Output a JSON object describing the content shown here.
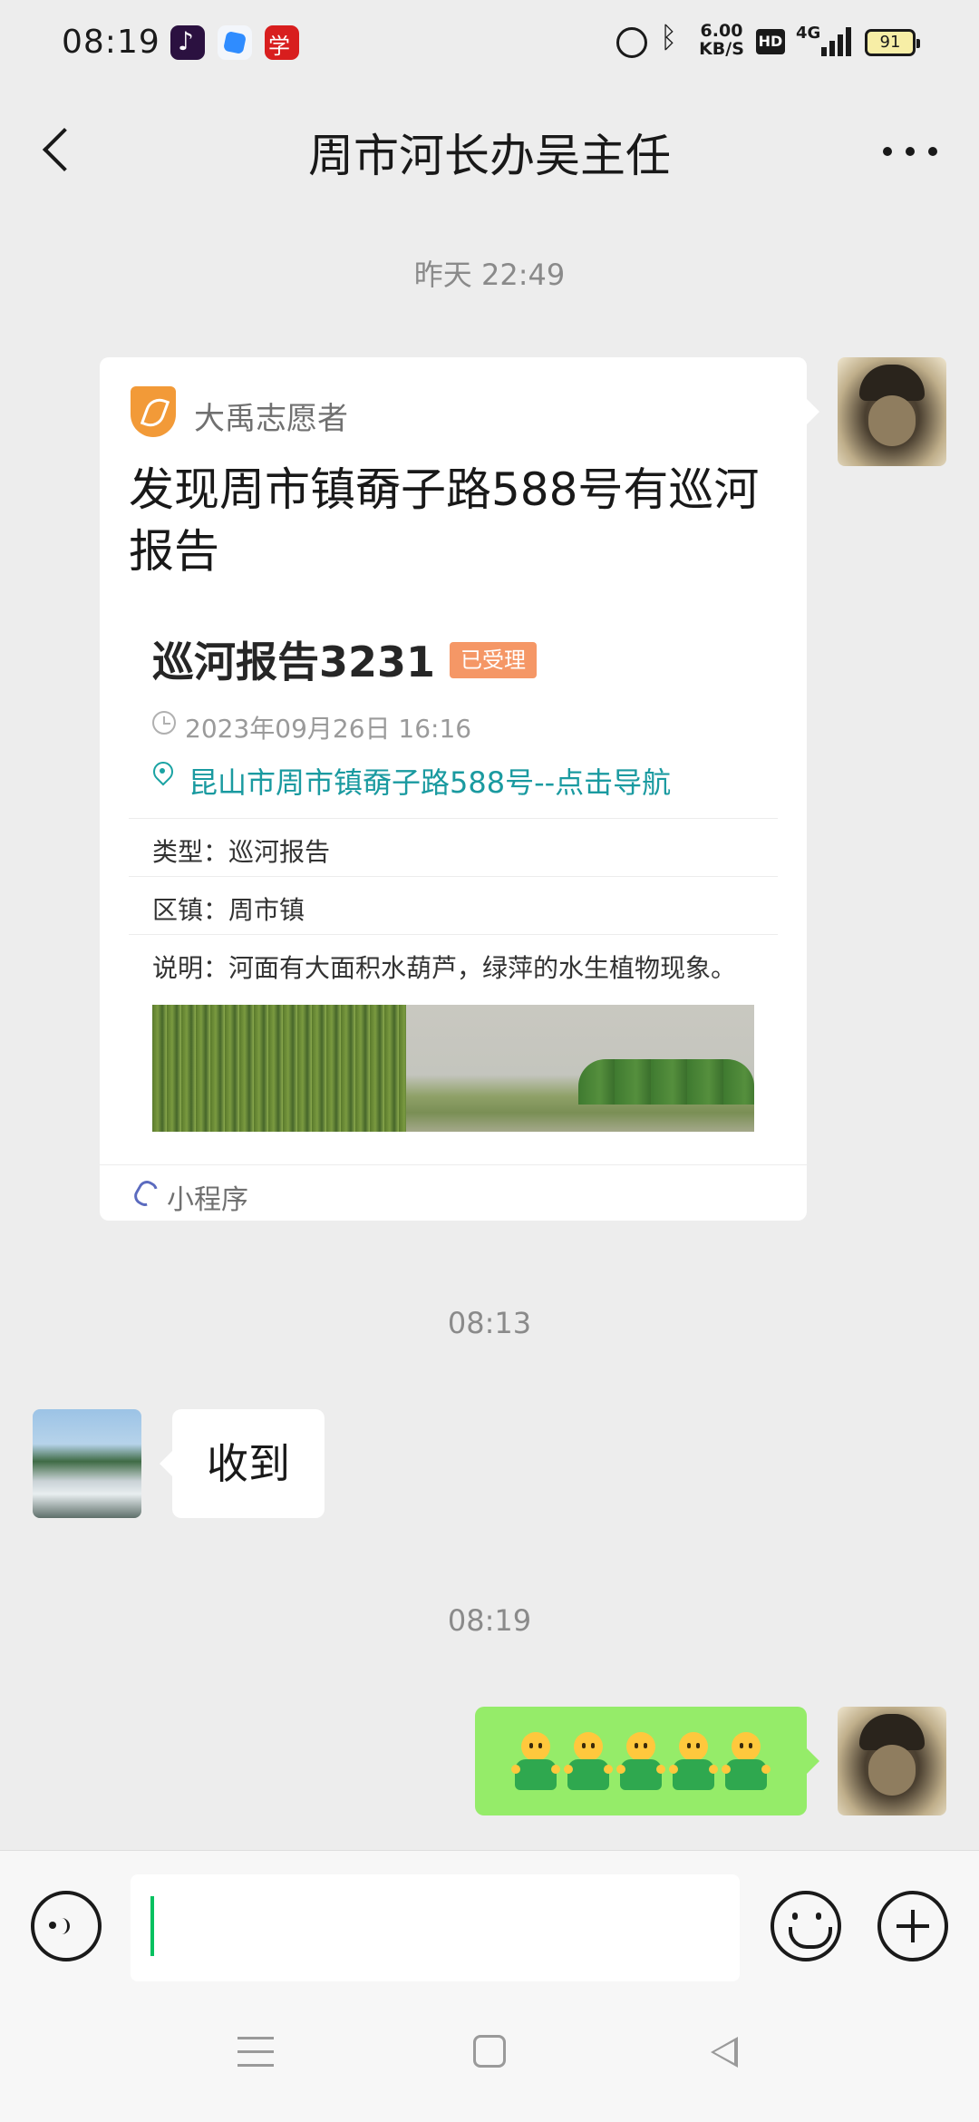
{
  "status_bar": {
    "time": "08:19",
    "app_icons": [
      "tiktok-icon",
      "blue-app-icon",
      "xuexi-app-icon"
    ],
    "net_speed_value": "6.00",
    "net_speed_unit": "KB/S",
    "hd_label": "HD",
    "network_label": "4G",
    "battery": "91"
  },
  "header": {
    "title": "周市河长办吴主任"
  },
  "messages": {
    "timestamp_1": "昨天 22:49",
    "timestamp_2": "08:13",
    "timestamp_3": "08:19",
    "reply_text": "收到",
    "emoji_reply": [
      "smiley-person-emoji",
      "smiley-person-emoji",
      "smiley-person-emoji",
      "smiley-person-emoji",
      "smiley-person-emoji"
    ]
  },
  "card": {
    "brand": "大禹志愿者",
    "title": "发现周市镇奣子路588号有巡河报告",
    "report_title": "巡河报告3231",
    "status_badge": "已受理",
    "time": "2023年09月26日 16:16",
    "location": "昆山市周市镇奣子路588号--点击导航",
    "type_row": "类型：巡河报告",
    "district_row": "区镇：周市镇",
    "desc_row": "说明：河面有大面积水葫芦，绿萍的水生植物现象。",
    "footer_label": "小程序"
  },
  "input_bar": {
    "placeholder": "",
    "value": ""
  },
  "colors": {
    "background": "#ededed",
    "sent_bubble": "#95ec69",
    "link": "#1a9aa0",
    "badge": "#f59766",
    "caret": "#07c160"
  }
}
